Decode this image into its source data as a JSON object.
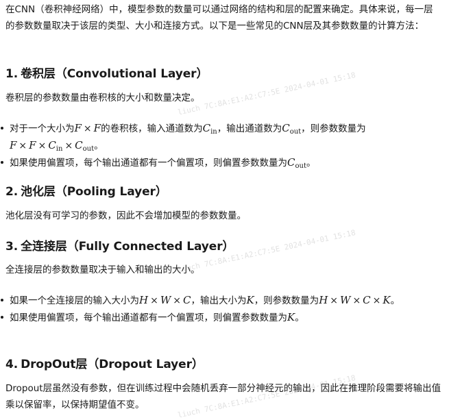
{
  "intro": "在CNN（卷积神经网络）中，模型参数的数量可以通过网络的结构和层的配置来确定。具体来说，每一层的参数数量取决于该层的类型、大小和连接方式。以下是一些常见的CNN层及其参数数量的计算方法：",
  "sections": [
    {
      "num": "1.",
      "title": "卷积层（Convolutional Layer）",
      "desc": "卷积层的参数数量由卷积核的大小和数量决定。",
      "bullets": [
        {
          "pre": "对于一个大小为",
          "m1": "F",
          "op1": "×",
          "m2": "F",
          "mid1": "的卷积核，输入通道数为",
          "cin": "C",
          "cin_sub": "in",
          "mid2": "，输出通道数为",
          "cout": "C",
          "cout_sub": "out",
          "mid3": "，则参数数量为",
          "f1": "F",
          "x1": "×",
          "f2": "F",
          "x2": "×",
          "c1": "C",
          "c1_sub": "in",
          "x3": "×",
          "c2": "C",
          "c2_sub": "out",
          "end": "。"
        },
        {
          "pre": "如果使用偏置项，每个输出通道都有一个偏置项，则偏置参数数量为",
          "c": "C",
          "c_sub": "out",
          "end": "。"
        }
      ]
    },
    {
      "num": "2.",
      "title": "池化层（Pooling Layer）",
      "desc": "池化层没有可学习的参数，因此不会增加模型的参数数量。"
    },
    {
      "num": "3.",
      "title": "全连接层（Fully Connected Layer）",
      "desc": "全连接层的参数数量取决于输入和输出的大小。",
      "bullets": [
        {
          "pre": "如果一个全连接层的输入大小为",
          "h": "H",
          "x1": "×",
          "w": "W",
          "x2": "×",
          "c": "C",
          "mid1": "，输出大小为",
          "k": "K",
          "mid2": "，则参数数量为",
          "h2": "H",
          "x3": "×",
          "w2": "W",
          "x4": "×",
          "c2": "C",
          "x5": "×",
          "k2": "K",
          "end": "。"
        },
        {
          "pre": "如果使用偏置项，每个输出通道都有一个偏置项，则偏置参数数量为",
          "k": "K",
          "end": "。"
        }
      ]
    },
    {
      "num": "4.",
      "title": "DropOut层（Dropout Layer）",
      "desc": "Dropout层虽然没有参数，但在训练过程中会随机丢弃一部分神经元的输出，因此在推理阶段需要将输出值乘以保留率，以保持期望值不变。"
    }
  ],
  "watermark": "liuch 7C:8A:E1:A2:C7:5E 2024-04-01 15:18"
}
